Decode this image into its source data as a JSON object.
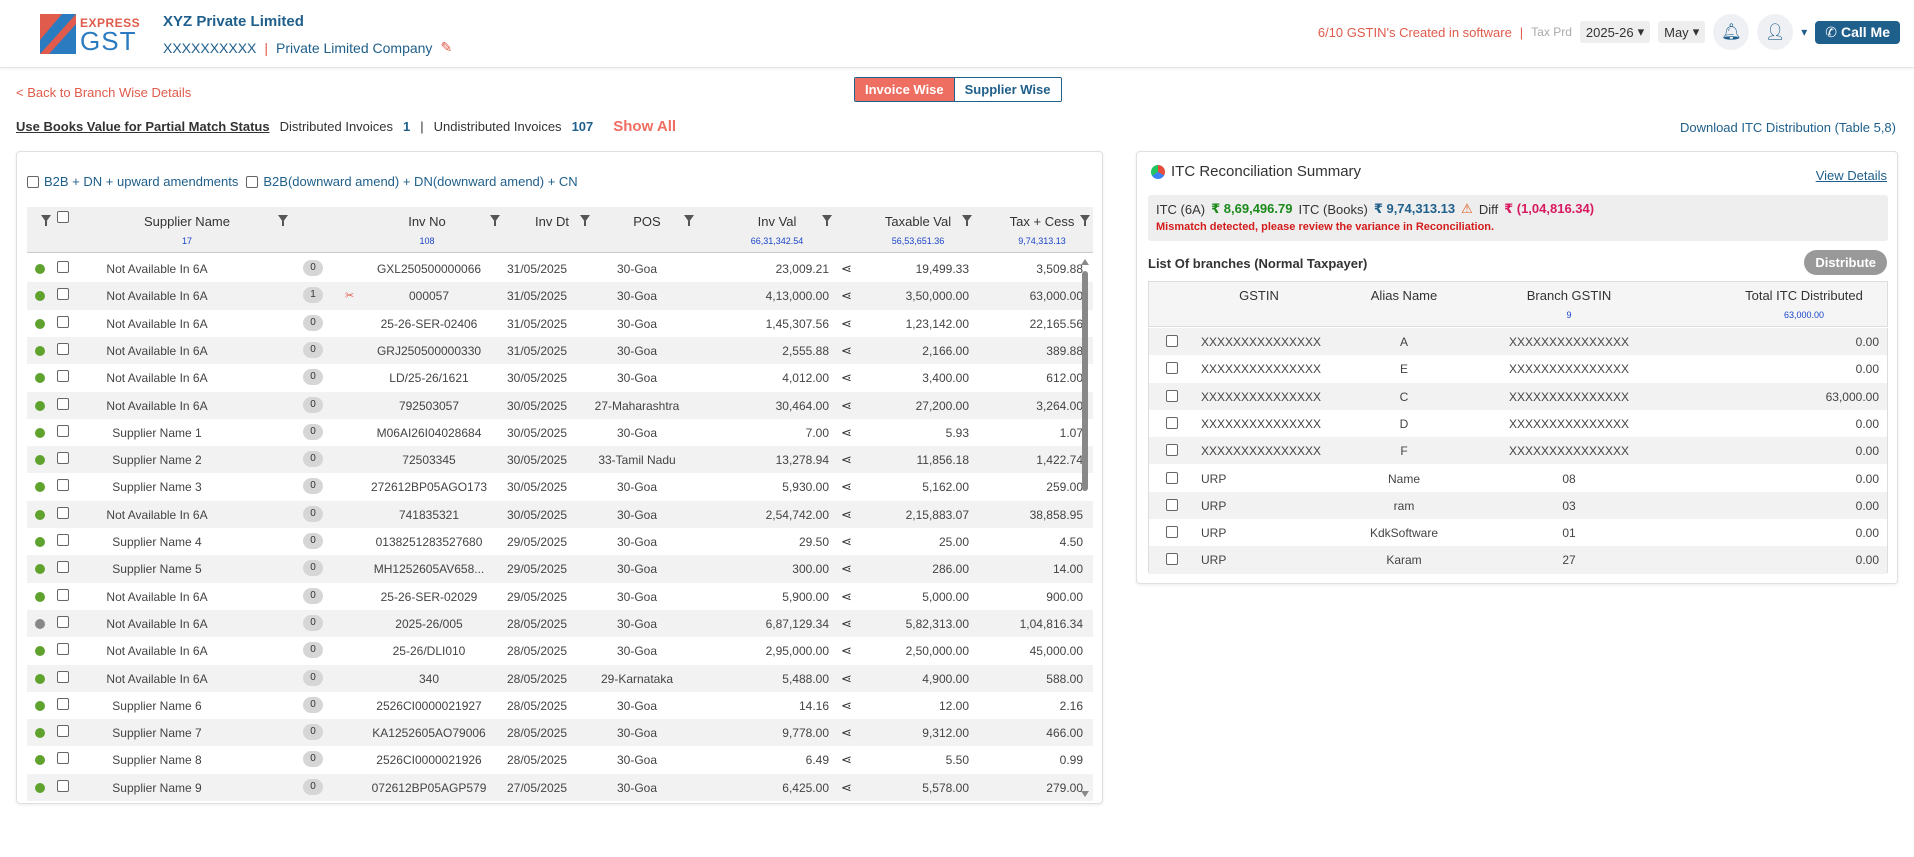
{
  "header": {
    "logo_top": "EXPRESS",
    "logo_bottom": "GST",
    "company_name": "XYZ Private Limited",
    "company_gstin": "XXXXXXXXXX",
    "company_type": "Private Limited Company",
    "gstin_created": "6/10 GSTIN's Created in software",
    "tax_prd_label": "Tax Prd",
    "year": "2025-26",
    "month": "May",
    "call_me": "Call Me"
  },
  "subheader": {
    "back_link": "< Back to Branch Wise Details",
    "toggle_invoice": "Invoice Wise",
    "toggle_supplier": "Supplier Wise",
    "books_value_link": "Use Books Value for Partial Match Status",
    "distributed_label": "Distributed Invoices",
    "distributed_count": "1",
    "undistributed_label": "Undistributed Invoices",
    "undistributed_count": "107",
    "show_all": "Show All",
    "download": "Download ITC Distribution (Table 5,8)"
  },
  "filters": {
    "b2b": "B2B + DN + upward amendments",
    "downward": "B2B(downward amend) + DN(downward amend) + CN"
  },
  "invoice_table": {
    "headers": {
      "supplier": "Supplier Name",
      "supplier_count": "17",
      "inv_no": "Inv No",
      "inv_no_count": "108",
      "inv_dt": "Inv Dt",
      "pos": "POS",
      "inv_val": "Inv Val",
      "inv_val_total": "66,31,342.54",
      "taxable": "Taxable Val",
      "taxable_total": "56,53,651.36",
      "tax": "Tax + Cess",
      "tax_total": "9,74,313.13"
    },
    "rows": [
      {
        "status": "green",
        "supplier": "Not Available In 6A",
        "count": "0",
        "inv_no": "GXL250500000066",
        "inv_dt": "31/05/2025",
        "pos": "30-Goa",
        "inv_val": "23,009.21",
        "taxable": "19,499.33",
        "tax": "3,509.88"
      },
      {
        "status": "green",
        "supplier": "Not Available In 6A",
        "count": "1",
        "inv_no": "000057",
        "inv_dt": "31/05/2025",
        "pos": "30-Goa",
        "inv_val": "4,13,000.00",
        "taxable": "3,50,000.00",
        "tax": "63,000.00",
        "flag": true
      },
      {
        "status": "green",
        "supplier": "Not Available In 6A",
        "count": "0",
        "inv_no": "25-26-SER-02406",
        "inv_dt": "31/05/2025",
        "pos": "30-Goa",
        "inv_val": "1,45,307.56",
        "taxable": "1,23,142.00",
        "tax": "22,165.56"
      },
      {
        "status": "green",
        "supplier": "Not Available In 6A",
        "count": "0",
        "inv_no": "GRJ250500000330",
        "inv_dt": "31/05/2025",
        "pos": "30-Goa",
        "inv_val": "2,555.88",
        "taxable": "2,166.00",
        "tax": "389.88"
      },
      {
        "status": "green",
        "supplier": "Not Available In 6A",
        "count": "0",
        "inv_no": "LD/25-26/1621",
        "inv_dt": "30/05/2025",
        "pos": "30-Goa",
        "inv_val": "4,012.00",
        "taxable": "3,400.00",
        "tax": "612.00"
      },
      {
        "status": "green",
        "supplier": "Not Available In 6A",
        "count": "0",
        "inv_no": "792503057",
        "inv_dt": "30/05/2025",
        "pos": "27-Maharashtra",
        "inv_val": "30,464.00",
        "taxable": "27,200.00",
        "tax": "3,264.00"
      },
      {
        "status": "green",
        "supplier": "Supplier Name 1",
        "count": "0",
        "inv_no": "M06AI26I04028684",
        "inv_dt": "30/05/2025",
        "pos": "30-Goa",
        "inv_val": "7.00",
        "taxable": "5.93",
        "tax": "1.07"
      },
      {
        "status": "green",
        "supplier": "Supplier Name 2",
        "count": "0",
        "inv_no": "72503345",
        "inv_dt": "30/05/2025",
        "pos": "33-Tamil Nadu",
        "inv_val": "13,278.94",
        "taxable": "11,856.18",
        "tax": "1,422.74"
      },
      {
        "status": "green",
        "supplier": "Supplier Name 3",
        "count": "0",
        "inv_no": "272612BP05AGO173",
        "inv_dt": "30/05/2025",
        "pos": "30-Goa",
        "inv_val": "5,930.00",
        "taxable": "5,162.00",
        "tax": "259.00"
      },
      {
        "status": "green",
        "supplier": "Not Available In 6A",
        "count": "0",
        "inv_no": "741835321",
        "inv_dt": "30/05/2025",
        "pos": "30-Goa",
        "inv_val": "2,54,742.00",
        "taxable": "2,15,883.07",
        "tax": "38,858.95"
      },
      {
        "status": "green",
        "supplier": "Supplier Name 4",
        "count": "0",
        "inv_no": "0138251283527680",
        "inv_dt": "29/05/2025",
        "pos": "30-Goa",
        "inv_val": "29.50",
        "taxable": "25.00",
        "tax": "4.50"
      },
      {
        "status": "green",
        "supplier": "Supplier Name 5",
        "count": "0",
        "inv_no": "MH1252605AV658...",
        "inv_dt": "29/05/2025",
        "pos": "30-Goa",
        "inv_val": "300.00",
        "taxable": "286.00",
        "tax": "14.00"
      },
      {
        "status": "green",
        "supplier": "Not Available In 6A",
        "count": "0",
        "inv_no": "25-26-SER-02029",
        "inv_dt": "29/05/2025",
        "pos": "30-Goa",
        "inv_val": "5,900.00",
        "taxable": "5,000.00",
        "tax": "900.00"
      },
      {
        "status": "gray",
        "supplier": "Not Available In 6A",
        "count": "0",
        "inv_no": "2025-26/005",
        "inv_dt": "28/05/2025",
        "pos": "30-Goa",
        "inv_val": "6,87,129.34",
        "taxable": "5,82,313.00",
        "tax": "1,04,816.34"
      },
      {
        "status": "green",
        "supplier": "Not Available In 6A",
        "count": "0",
        "inv_no": "25-26/DLI010",
        "inv_dt": "28/05/2025",
        "pos": "30-Goa",
        "inv_val": "2,95,000.00",
        "taxable": "2,50,000.00",
        "tax": "45,000.00"
      },
      {
        "status": "green",
        "supplier": "Not Available In 6A",
        "count": "0",
        "inv_no": "340",
        "inv_dt": "28/05/2025",
        "pos": "29-Karnataka",
        "inv_val": "5,488.00",
        "taxable": "4,900.00",
        "tax": "588.00"
      },
      {
        "status": "green",
        "supplier": "Supplier Name 6",
        "count": "0",
        "inv_no": "2526CI0000021927",
        "inv_dt": "28/05/2025",
        "pos": "30-Goa",
        "inv_val": "14.16",
        "taxable": "12.00",
        "tax": "2.16"
      },
      {
        "status": "green",
        "supplier": "Supplier Name 7",
        "count": "0",
        "inv_no": "KA1252605AO79006",
        "inv_dt": "28/05/2025",
        "pos": "30-Goa",
        "inv_val": "9,778.00",
        "taxable": "9,312.00",
        "tax": "466.00"
      },
      {
        "status": "green",
        "supplier": "Supplier Name 8",
        "count": "0",
        "inv_no": "2526CI0000021926",
        "inv_dt": "28/05/2025",
        "pos": "30-Goa",
        "inv_val": "6.49",
        "taxable": "5.50",
        "tax": "0.99"
      },
      {
        "status": "green",
        "supplier": "Supplier Name 9",
        "count": "0",
        "inv_no": "072612BP05AGP579",
        "inv_dt": "27/05/2025",
        "pos": "30-Goa",
        "inv_val": "6,425.00",
        "taxable": "5,578.00",
        "tax": "279.00"
      }
    ]
  },
  "summary": {
    "title": "ITC Reconciliation Summary",
    "view_details": "View Details",
    "itc_6a_label": "ITC (6A)",
    "itc_6a_value": "₹ 8,69,496.79",
    "itc_books_label": "ITC (Books)",
    "itc_books_value": "₹ 9,74,313.13",
    "diff_label": "Diff",
    "diff_value": "₹ (1,04,816.34)",
    "mismatch": "Mismatch detected, please review the variance in Reconciliation.",
    "branches_title": "List Of branches (Normal Taxpayer)",
    "distribute": "Distribute"
  },
  "branch_table": {
    "headers": {
      "gstin": "GSTIN",
      "alias": "Alias Name",
      "branch_gstin": "Branch GSTIN",
      "branch_count": "9",
      "total": "Total ITC Distributed",
      "total_value": "63,000.00"
    },
    "rows": [
      {
        "gstin": "XXXXXXXXXXXXXXX",
        "alias": "A",
        "branch_gstin": "XXXXXXXXXXXXXXX",
        "total": "0.00"
      },
      {
        "gstin": "XXXXXXXXXXXXXXX",
        "alias": "E",
        "branch_gstin": "XXXXXXXXXXXXXXX",
        "total": "0.00"
      },
      {
        "gstin": "XXXXXXXXXXXXXXX",
        "alias": "C",
        "branch_gstin": "XXXXXXXXXXXXXXX",
        "total": "63,000.00"
      },
      {
        "gstin": "XXXXXXXXXXXXXXX",
        "alias": "D",
        "branch_gstin": "XXXXXXXXXXXXXXX",
        "total": "0.00"
      },
      {
        "gstin": "XXXXXXXXXXXXXXX",
        "alias": "F",
        "branch_gstin": "XXXXXXXXXXXXXXX",
        "total": "0.00"
      },
      {
        "gstin": "URP",
        "alias": "Name",
        "branch_gstin": "08",
        "total": "0.00"
      },
      {
        "gstin": "URP",
        "alias": "ram",
        "branch_gstin": "03",
        "total": "0.00"
      },
      {
        "gstin": "URP",
        "alias": "KdkSoftware",
        "branch_gstin": "01",
        "total": "0.00"
      },
      {
        "gstin": "URP",
        "alias": "Karam",
        "branch_gstin": "27",
        "total": "0.00"
      }
    ]
  }
}
